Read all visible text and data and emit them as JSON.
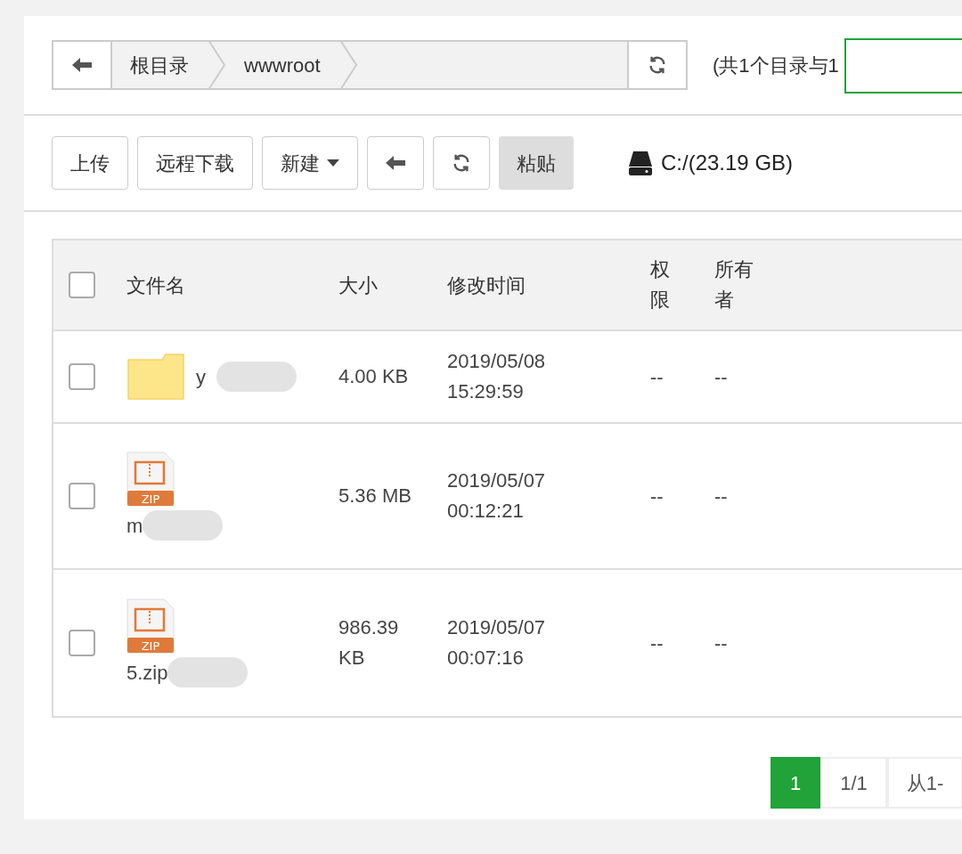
{
  "breadcrumb": {
    "items": [
      "根目录",
      "wwwroot"
    ],
    "summary": "(共1个目录与1"
  },
  "toolbar": {
    "buttons": [
      {
        "kind": "text",
        "label": "上传"
      },
      {
        "kind": "text",
        "label": "远程下载"
      },
      {
        "kind": "dropdown",
        "label": "新建"
      },
      {
        "kind": "back"
      },
      {
        "kind": "refresh"
      },
      {
        "kind": "paste",
        "label": "粘贴"
      }
    ],
    "disk": "C:/(23.19 GB)"
  },
  "table": {
    "select_all_checked": false,
    "columns": [
      "文件名",
      "大小",
      "修改时间",
      "权限",
      "所有者"
    ],
    "rows": [
      {
        "kind": "folder",
        "checked": false,
        "name": "y",
        "size": "4.00 KB",
        "modified": [
          "2019/05/08",
          "15:29:59"
        ],
        "permission": "--",
        "owner": "--"
      },
      {
        "kind": "zip",
        "badge": "ZIP",
        "checked": false,
        "name": "m",
        "size": "5.36 MB",
        "modified": [
          "2019/05/07",
          "00:12:21"
        ],
        "permission": "--",
        "owner": "--"
      },
      {
        "kind": "zip",
        "badge": "ZIP",
        "checked": false,
        "name": "5.zip",
        "size": "986.39 KB",
        "modified": [
          "2019/05/07",
          "00:07:16"
        ],
        "permission": "--",
        "owner": "--"
      }
    ]
  },
  "pagination": [
    {
      "label": "1",
      "selected": true
    },
    {
      "label": "1/1",
      "selected": false
    },
    {
      "label": "从1-",
      "selected": false
    }
  ]
}
